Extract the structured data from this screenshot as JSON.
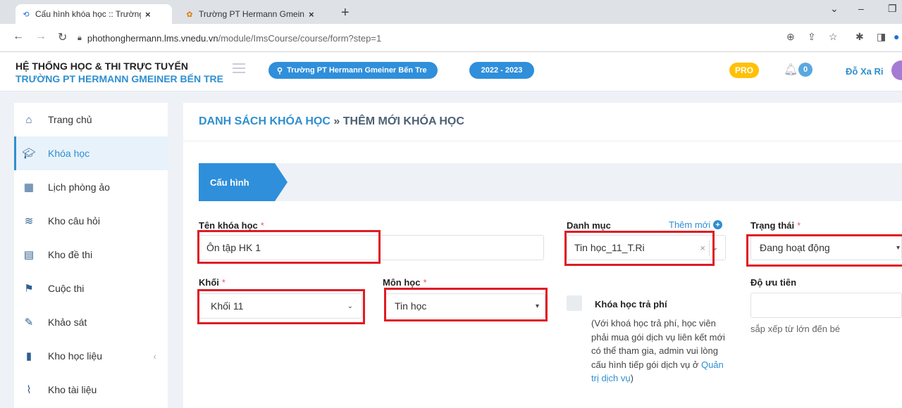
{
  "browser": {
    "tabs": [
      {
        "title": "Cấu hình khóa học :: Trường PT H",
        "active": true
      },
      {
        "title": "Trường PT Hermann Gmeiner Bến",
        "active": false
      }
    ],
    "new_tab": "+",
    "url_host": "phothonghermann.lms.vnedu.vn",
    "url_path": "/module/ImsCourse/course/form?step=1"
  },
  "header": {
    "system_title": "HỆ THỐNG HỌC & THI TRỰC TUYẾN",
    "school_title": "TRƯỜNG PT HERMANN GMEINER BẾN TRE",
    "school_pill": "Trường PT Hermann Gmeiner Bến Tre",
    "year_pill": "2022 - 2023",
    "pro_badge": "PRO",
    "notification_count": "0",
    "user_name": "Đỗ Xa Ri"
  },
  "sidebar": {
    "items": [
      {
        "label": "Trang chủ",
        "icon": "home-icon",
        "active": false
      },
      {
        "label": "Khóa học",
        "icon": "graduation-cap-icon",
        "active": true
      },
      {
        "label": "Lịch phòng ảo",
        "icon": "calendar-icon",
        "active": false
      },
      {
        "label": "Kho câu hỏi",
        "icon": "database-icon",
        "active": false
      },
      {
        "label": "Kho đề thi",
        "icon": "file-icon",
        "active": false
      },
      {
        "label": "Cuộc thi",
        "icon": "flag-icon",
        "active": false
      },
      {
        "label": "Khảo sát",
        "icon": "pen-icon",
        "active": false
      },
      {
        "label": "Kho học liệu",
        "icon": "book-icon",
        "active": false
      },
      {
        "label": "Kho tài liệu",
        "icon": "paperclip-icon",
        "active": false
      }
    ]
  },
  "main": {
    "breadcrumb_parent": "DANH SÁCH KHÓA HỌC",
    "breadcrumb_sep": " » ",
    "breadcrumb_current": "THÊM MỚI KHÓA HỌC",
    "step_label": "Cấu hình",
    "form": {
      "course_name_label": "Tên khóa học",
      "course_name_value": "Ôn tập HK 1",
      "category_label": "Danh mục",
      "add_new_label": "Thêm mới",
      "category_value": "Tin học_11_T.Ri",
      "status_label": "Trạng thái",
      "status_value": "Đang hoạt động",
      "grade_label": "Khối",
      "grade_value": "Khối 11",
      "subject_label": "Môn học",
      "subject_value": "Tin học",
      "paid_label": "Khóa học trả phí",
      "paid_desc": "(Với khoá học trả phí, học viên phải mua gói dịch vụ liên kết mới có thể tham gia, admin vui lòng cấu hình tiếp gói dịch vụ ở ",
      "paid_link": "Quản trị dịch vụ",
      "paid_desc_end": ")",
      "priority_label": "Độ ưu tiên",
      "priority_value": "",
      "priority_hint": "sắp xếp từ lớn đến bé",
      "required_mark": "*"
    }
  },
  "colors": {
    "accent": "#2f8fdb",
    "highlight_box": "#e01b24",
    "pro": "#ffc107"
  }
}
